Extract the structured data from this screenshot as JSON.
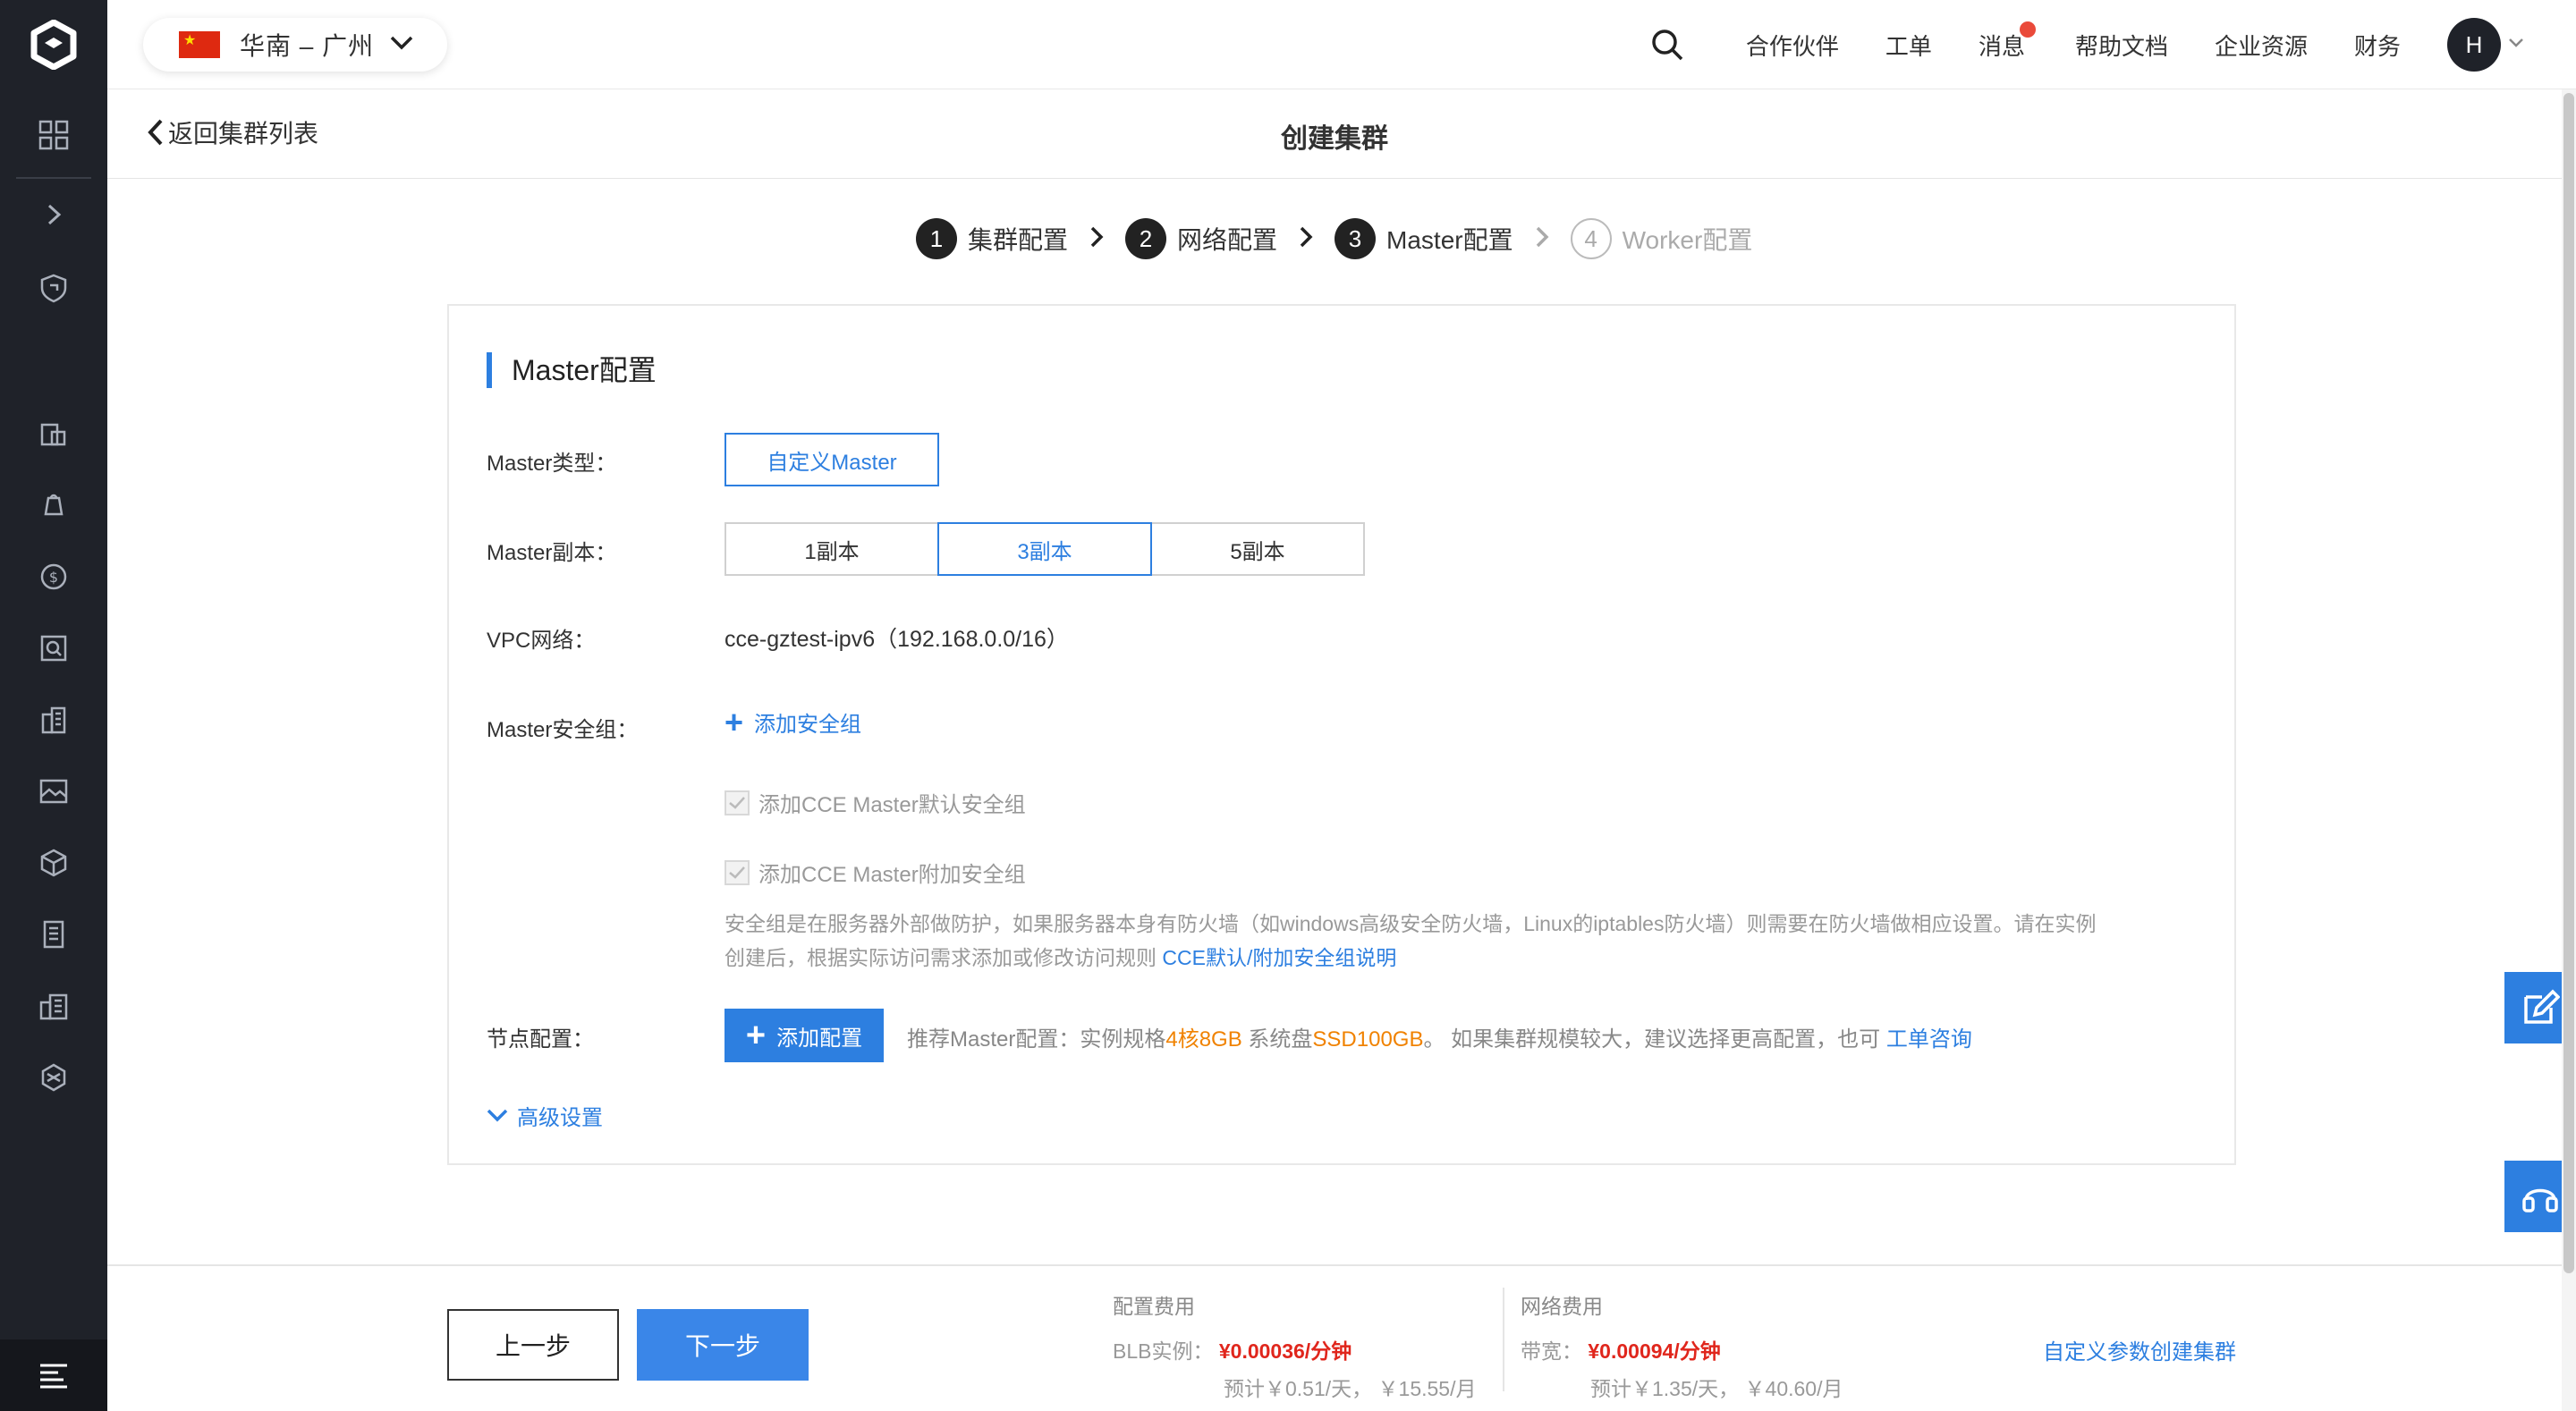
{
  "header": {
    "region": "华南 – 广州",
    "nav": [
      {
        "label": "合作伙伴"
      },
      {
        "label": "工单"
      },
      {
        "label": "消息"
      },
      {
        "label": "帮助文档"
      },
      {
        "label": "企业资源"
      },
      {
        "label": "财务"
      }
    ],
    "avatar_letter": "H"
  },
  "subheader": {
    "back_label": "返回集群列表",
    "title": "创建集群"
  },
  "steps": [
    {
      "num": "1",
      "label": "集群配置"
    },
    {
      "num": "2",
      "label": "网络配置"
    },
    {
      "num": "3",
      "label": "Master配置"
    },
    {
      "num": "4",
      "label": "Worker配置"
    }
  ],
  "form": {
    "section_title": "Master配置",
    "master_type_label": "Master类型：",
    "master_type_option": "自定义Master",
    "replica_label": "Master副本：",
    "replica_options": [
      "1副本",
      "3副本",
      "5副本"
    ],
    "vpc_label": "VPC网络：",
    "vpc_value": "cce-gztest-ipv6（192.168.0.0/16）",
    "sg_label": "Master安全组：",
    "sg_add": "添加安全组",
    "sg_default": "添加CCE Master默认安全组",
    "sg_extra": "添加CCE Master附加安全组",
    "sg_help_1": "安全组是在服务器外部做防护，如果服务器本身有防火墙（如windows高级安全防火墙，Linux的iptables防火墙）则需要在防火墙做相应设置。请在实例",
    "sg_help_2": "创建后，根据实际访问需求添加或修改访问规则 ",
    "sg_help_link": "CCE默认/附加安全组说明",
    "node_label": "节点配置：",
    "node_add": "添加配置",
    "rec_prefix": "推荐Master配置：实例规格",
    "rec_spec": "4核8GB",
    "rec_mid": " 系统盘",
    "rec_disk": "SSD100GB",
    "rec_suffix": "。 如果集群规模较大，建议选择更高配置，也可 ",
    "rec_link": "工单咨询",
    "advanced": "高级设置"
  },
  "footer": {
    "prev": "上一步",
    "next": "下一步",
    "config_fee_title": "配置费用",
    "config_fee_label": "BLB实例：",
    "config_fee_price": "¥0.00036/分钟",
    "config_fee_sub": "预计￥0.51/天， ￥15.55/月",
    "net_fee_title": "网络费用",
    "net_fee_label": "带宽：",
    "net_fee_price": "¥0.00094/分钟",
    "net_fee_sub": "预计￥1.35/天， ￥40.60/月",
    "custom_link": "自定义参数创建集群"
  },
  "colors": {
    "accent": "#2d7fe0",
    "sidebar": "#1f2229",
    "price": "#e0261c",
    "highlight": "#f08200"
  }
}
